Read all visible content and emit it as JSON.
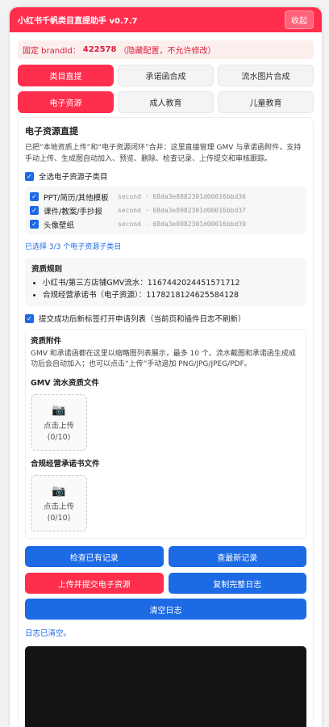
{
  "header": {
    "title": "小红书千帆类目直提助手 v0.7.7",
    "collapse_label": "收起"
  },
  "brand": {
    "prefix": "固定 brandId：",
    "id": "422578",
    "suffix": "（隐藏配置，不允许修改）"
  },
  "tabs_primary": [
    {
      "label": "类目直提",
      "active": true
    },
    {
      "label": "承诺函合成",
      "active": false
    },
    {
      "label": "流水图片合成",
      "active": false
    }
  ],
  "tabs_secondary": [
    {
      "label": "电子资源",
      "active": true
    },
    {
      "label": "成人教育",
      "active": false
    },
    {
      "label": "儿童教育",
      "active": false
    }
  ],
  "section": {
    "title": "电子资源直提",
    "description": "已把“本地资质上传”和“电子资源闭环”合并：这里直接管理 GMV 与承诺函附件，支持手动上传、生成图自动加入、预览、删除、检查记录、上传提交和审核跟踪。",
    "select_all_label": "全选电子资源子类目",
    "subcategories": [
      {
        "name": "PPT/简历/其他模板",
        "code": "second · 68da3e8882301d00016bbd36"
      },
      {
        "name": "课件/教案/手抄报",
        "code": "second · 68da3e8982301d00016bbd37"
      },
      {
        "name": "头像壁纸",
        "code": "second · 68da3e8982301d00016bbd39"
      }
    ],
    "selected_info": "已选择 3/3 个电子资源子类目"
  },
  "rules": {
    "label": "资质规则",
    "items": [
      "小红书/第三方店铺GMV流水：1167442024451571712",
      "合规经营承诺书（电子资源）：1178218124625584128"
    ]
  },
  "auto_open_label": "提交成功后新标签打开申请列表（当前页和插件日志不刷新）",
  "attachments": {
    "label": "资质附件",
    "description": "GMV 和承诺函都在这里以缩略图列表展示，最多 10 个。流水截图和承诺函生成成功后会自动加入；也可以点击“上传”手动追加 PNG/JPG/JPEG/PDF。",
    "groups": [
      {
        "label": "GMV 流水资质文件",
        "upload_text": "点击上传",
        "count": "(0/10)"
      },
      {
        "label": "合规经营承诺书文件",
        "upload_text": "点击上传",
        "count": "(0/10)"
      }
    ]
  },
  "actions": {
    "check_records": "检查已有记录",
    "view_latest": "查最新记录",
    "upload_submit": "上传并提交电子资源",
    "copy_log": "复制完整日志",
    "clear_log": "清空日志"
  },
  "log_status": "日志已清空。",
  "colors": {
    "accent_red": "#ff2e4d",
    "accent_blue": "#1d6ae5",
    "log_bg": "#141414"
  }
}
